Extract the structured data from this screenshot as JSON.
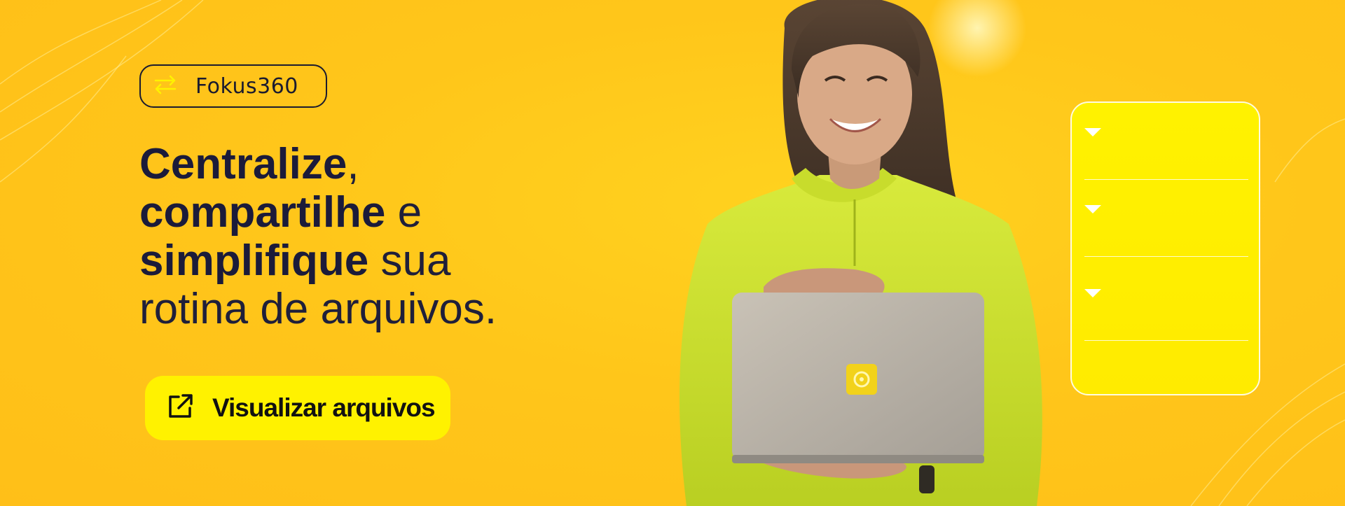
{
  "badge": {
    "label": "Fokus360",
    "icon": "swap-arrows-icon"
  },
  "headline": {
    "line1_bold": "Centralize",
    "line1_rest": ",",
    "line2_bold": "compartilhe",
    "line2_rest": " e",
    "line3_bold": "simplifique",
    "line3_rest": " sua",
    "line4": "rotina de arquivos."
  },
  "cta": {
    "label": "Visualizar arquivos",
    "icon": "external-link-icon"
  },
  "panel": {
    "rows": 3
  },
  "colors": {
    "background": "#ffc61a",
    "accent": "#fff200",
    "text": "#1b1b3a"
  }
}
